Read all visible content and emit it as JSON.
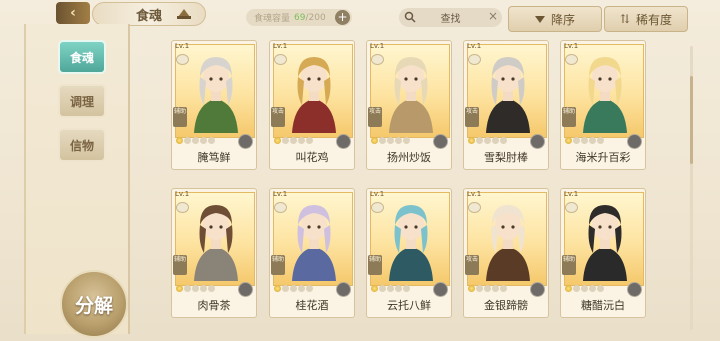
{
  "header": {
    "title": "食魂",
    "capacity": {
      "label": "食魂容量",
      "current": "69",
      "max": "/200"
    },
    "search_label": "查找",
    "sort_label": "降序",
    "rarity_label": "稀有度"
  },
  "sidebar": {
    "tabs": [
      {
        "label": "食魂",
        "active": true
      },
      {
        "label": "调理",
        "active": false
      },
      {
        "label": "信物",
        "active": false
      }
    ],
    "decompose_label": "分解"
  },
  "cards": [
    {
      "level": "Lv.1",
      "role": "辅助",
      "name": "腌笃鲜",
      "stars": 1,
      "hair": "#d7d4cf",
      "outfit": "#4f7a3a"
    },
    {
      "level": "Lv.1",
      "role": "攻击",
      "name": "叫花鸡",
      "stars": 1,
      "hair": "#d6aa55",
      "outfit": "#8c2f2a"
    },
    {
      "level": "Lv.1",
      "role": "攻击",
      "name": "扬州炒饭",
      "stars": 1,
      "hair": "#e8d9b6",
      "outfit": "#b89a6a"
    },
    {
      "level": "Lv.1",
      "role": "攻击",
      "name": "雪梨肘棒",
      "stars": 1,
      "hair": "#cfcbc6",
      "outfit": "#2f2b29"
    },
    {
      "level": "Lv.1",
      "role": "辅助",
      "name": "海米升百彩",
      "stars": 1,
      "hair": "#f1d88c",
      "outfit": "#3a7a5c"
    },
    {
      "level": "Lv.1",
      "role": "辅助",
      "name": "肉骨茶",
      "stars": 1,
      "hair": "#6e4e34",
      "outfit": "#8a8378"
    },
    {
      "level": "Lv.1",
      "role": "辅助",
      "name": "桂花酒",
      "stars": 1,
      "hair": "#cfc0e0",
      "outfit": "#5a6aa0"
    },
    {
      "level": "Lv.1",
      "role": "辅助",
      "name": "云托八鲜",
      "stars": 1,
      "hair": "#7cc2cc",
      "outfit": "#2e5b63"
    },
    {
      "level": "Lv.1",
      "role": "攻击",
      "name": "金银蹄髈",
      "stars": 1,
      "hair": "#f0e3cf",
      "outfit": "#5a3b26"
    },
    {
      "level": "Lv.1",
      "role": "辅助",
      "name": "糖醋沅白",
      "stars": 1,
      "hair": "#2e2b2b",
      "outfit": "#2a2a2a"
    }
  ]
}
